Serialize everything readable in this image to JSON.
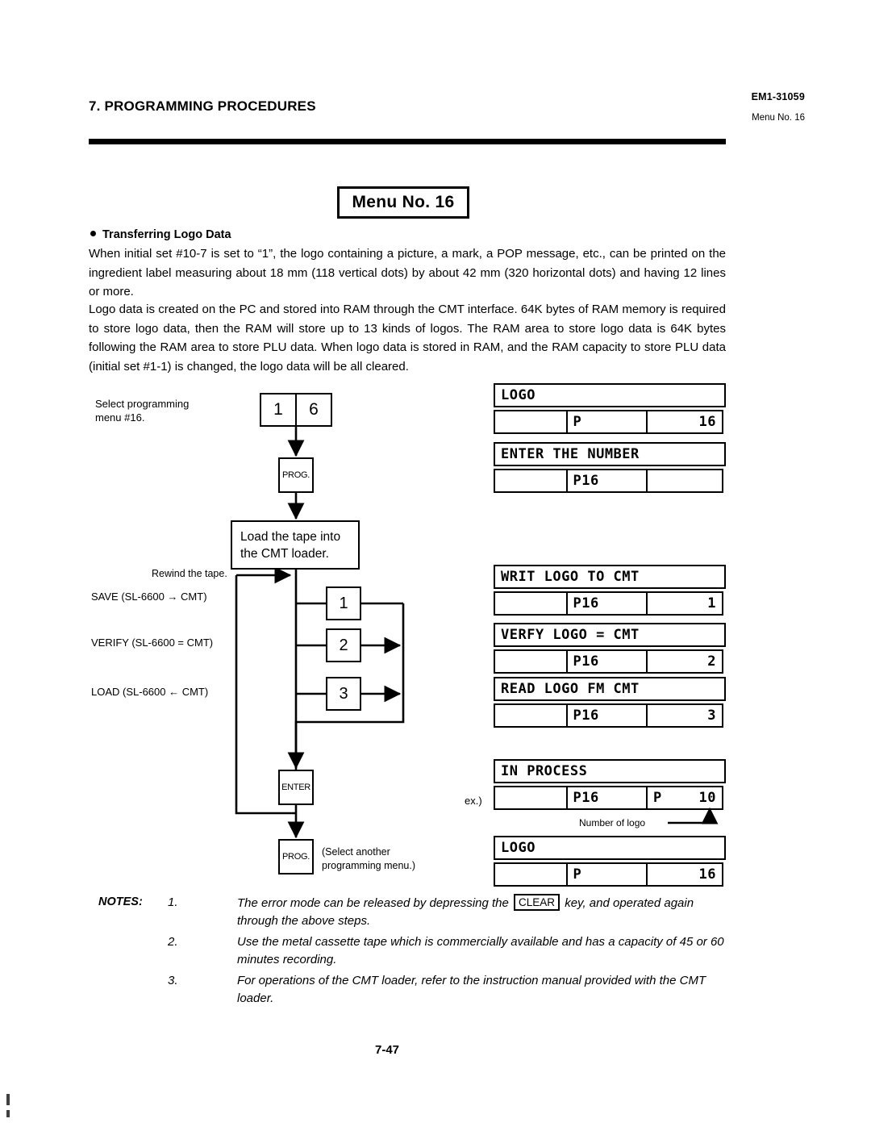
{
  "header": {
    "section_title": "7. PROGRAMMING PROCEDURES",
    "doc_code": "EM1-31059",
    "menu_ref": "Menu No. 16"
  },
  "title_box": {
    "label": "Menu No. 16"
  },
  "content": {
    "bullet_heading": "Transferring Logo Data",
    "paragraph_1": "When initial set #10-7 is set to “1”, the logo containing a picture, a mark, a POP message, etc., can be printed on the ingredient label measuring about 18 mm (118 vertical dots) by about 42 mm (320 horizontal dots) and having 12 lines or more.",
    "paragraph_2": "Logo data is created on the PC and stored into RAM through the CMT interface.  64K bytes of RAM memory is required to store logo data, then the RAM will store up to 13 kinds of logos.  The RAM area to store logo data is 64K bytes following the RAM area to store PLU data.  When logo data is stored in RAM, and the RAM capacity to store PLU data (initial set #1-1) is changed, the logo data will be all cleared."
  },
  "flowchart": {
    "select_menu_label": "Select programming\nmenu #16.",
    "keypad": {
      "digit_1": "1",
      "digit_2": "6"
    },
    "prog_key_top": "PROG.",
    "load_tape_box": "Load the tape into\nthe CMT loader.",
    "rewind_label": "Rewind the tape.",
    "option_labels": [
      "SAVE (SL-6600 → CMT)",
      "VERIFY (SL-6600 = CMT)",
      "LOAD (SL-6600 ← CMT)"
    ],
    "option_keys": [
      "1",
      "2",
      "3"
    ],
    "enter_key": "ENTER",
    "prog_key_bottom": "PROG.",
    "select_another_label": "(Select another\nprogramming menu.)"
  },
  "displays": [
    {
      "name": "logo-initial",
      "line1": "LOGO",
      "cells": [
        {
          "left": "",
          "right": ""
        },
        {
          "left": "P",
          "right": ""
        },
        {
          "left": "",
          "right": "16"
        }
      ]
    },
    {
      "name": "enter-the-number",
      "line1": "ENTER THE NUMBER",
      "cells": [
        {
          "left": "",
          "right": ""
        },
        {
          "left": "P16",
          "right": ""
        },
        {
          "left": "",
          "right": ""
        }
      ]
    },
    {
      "name": "writ-logo-to-cmt",
      "line1": "WRIT LOGO TO CMT",
      "cells": [
        {
          "left": "",
          "right": ""
        },
        {
          "left": "P16",
          "right": ""
        },
        {
          "left": "",
          "right": "1"
        }
      ]
    },
    {
      "name": "verfy-logo-eq-cmt",
      "line1": "VERFY LOGO = CMT",
      "cells": [
        {
          "left": "",
          "right": ""
        },
        {
          "left": "P16",
          "right": ""
        },
        {
          "left": "",
          "right": "2"
        }
      ]
    },
    {
      "name": "read-logo-fm-cmt",
      "line1": "READ LOGO FM CMT",
      "cells": [
        {
          "left": "",
          "right": ""
        },
        {
          "left": "P16",
          "right": ""
        },
        {
          "left": "",
          "right": "3"
        }
      ]
    },
    {
      "name": "in-process",
      "line1": "IN PROCESS",
      "cells": [
        {
          "left": "",
          "right": ""
        },
        {
          "left": "P16",
          "right": ""
        },
        {
          "left": "P",
          "right": "10"
        }
      ]
    },
    {
      "name": "logo-final",
      "line1": "LOGO",
      "cells": [
        {
          "left": "",
          "right": ""
        },
        {
          "left": "P",
          "right": ""
        },
        {
          "left": "",
          "right": "16"
        }
      ]
    }
  ],
  "annotations": {
    "example_prefix": "ex.)",
    "number_of_logo": "Number of logo"
  },
  "notes": {
    "heading": "NOTES:",
    "items": [
      {
        "num": "1.",
        "text_before_key": "The error mode can be released by depressing the ",
        "key": "CLEAR",
        "text_after_key": " key, and operated again through the above steps."
      },
      {
        "num": "2.",
        "text": "Use the metal cassette tape which is commercially available and has a capacity of 45 or 60 minutes recording."
      },
      {
        "num": "3.",
        "text": "For operations of the CMT loader, refer to the instruction manual provided with the CMT loader."
      }
    ]
  },
  "footer": {
    "page_number": "7-47"
  }
}
